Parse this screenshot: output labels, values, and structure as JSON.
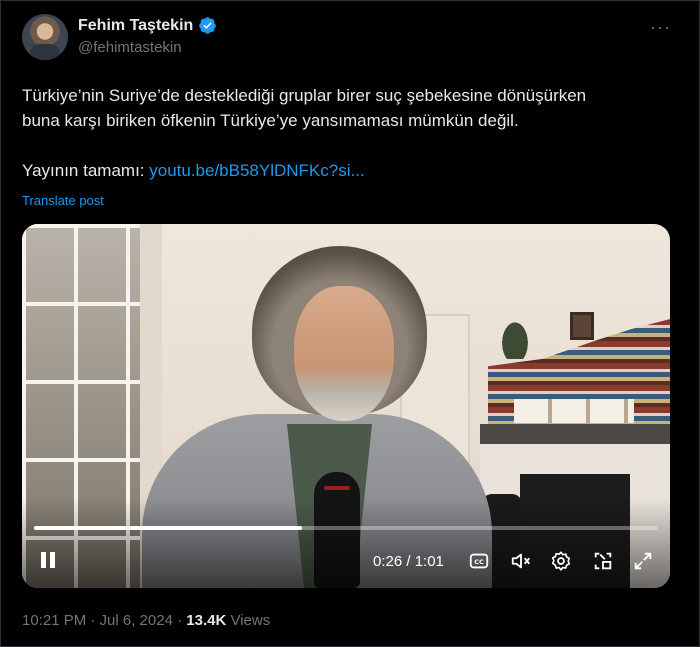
{
  "author": {
    "display_name": "Fehim Taştekin",
    "handle": "@fehimtastekin"
  },
  "tweet": {
    "line1": "Türkiye’nin Suriye’de desteklediği gruplar birer suç şebekesine dönüşürken",
    "line2": "buna karşı biriken öfkenin Türkiye’ye yansımaması mümkün değil.",
    "link_prefix": "Yayının tamamı: ",
    "link_text": "youtu.be/bB58YlDNFKc?si...",
    "translate_label": "Translate post"
  },
  "video": {
    "time_display": "0:26 / 1:01",
    "progress": 0.43
  },
  "meta": {
    "timestamp": "10:21 PM · Jul 6, 2024 · ",
    "views_count": "13.4K",
    "views_label": " Views"
  },
  "colors": {
    "accent": "#1d9bf0",
    "muted": "#71767b",
    "text": "#e7e9ea",
    "background": "#000000"
  },
  "icons": [
    "verified-badge-icon",
    "more-options-icon",
    "pause-icon",
    "captions-icon",
    "mute-icon",
    "settings-icon",
    "pip-icon",
    "fullscreen-icon"
  ]
}
